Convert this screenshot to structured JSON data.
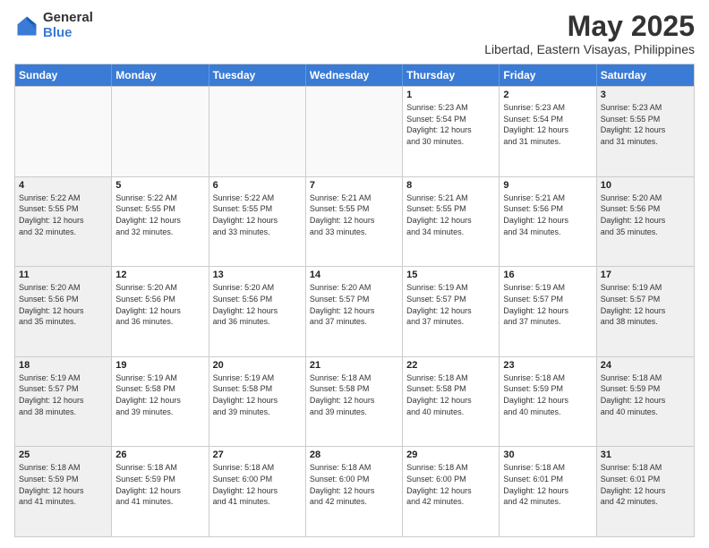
{
  "logo": {
    "general": "General",
    "blue": "Blue"
  },
  "header": {
    "title": "May 2025",
    "subtitle": "Libertad, Eastern Visayas, Philippines"
  },
  "weekdays": [
    "Sunday",
    "Monday",
    "Tuesday",
    "Wednesday",
    "Thursday",
    "Friday",
    "Saturday"
  ],
  "rows": [
    [
      {
        "day": "",
        "text": "",
        "empty": true
      },
      {
        "day": "",
        "text": "",
        "empty": true
      },
      {
        "day": "",
        "text": "",
        "empty": true
      },
      {
        "day": "",
        "text": "",
        "empty": true
      },
      {
        "day": "1",
        "text": "Sunrise: 5:23 AM\nSunset: 5:54 PM\nDaylight: 12 hours\nand 30 minutes.",
        "empty": false
      },
      {
        "day": "2",
        "text": "Sunrise: 5:23 AM\nSunset: 5:54 PM\nDaylight: 12 hours\nand 31 minutes.",
        "empty": false
      },
      {
        "day": "3",
        "text": "Sunrise: 5:23 AM\nSunset: 5:55 PM\nDaylight: 12 hours\nand 31 minutes.",
        "empty": false
      }
    ],
    [
      {
        "day": "4",
        "text": "Sunrise: 5:22 AM\nSunset: 5:55 PM\nDaylight: 12 hours\nand 32 minutes.",
        "empty": false
      },
      {
        "day": "5",
        "text": "Sunrise: 5:22 AM\nSunset: 5:55 PM\nDaylight: 12 hours\nand 32 minutes.",
        "empty": false
      },
      {
        "day": "6",
        "text": "Sunrise: 5:22 AM\nSunset: 5:55 PM\nDaylight: 12 hours\nand 33 minutes.",
        "empty": false
      },
      {
        "day": "7",
        "text": "Sunrise: 5:21 AM\nSunset: 5:55 PM\nDaylight: 12 hours\nand 33 minutes.",
        "empty": false
      },
      {
        "day": "8",
        "text": "Sunrise: 5:21 AM\nSunset: 5:55 PM\nDaylight: 12 hours\nand 34 minutes.",
        "empty": false
      },
      {
        "day": "9",
        "text": "Sunrise: 5:21 AM\nSunset: 5:56 PM\nDaylight: 12 hours\nand 34 minutes.",
        "empty": false
      },
      {
        "day": "10",
        "text": "Sunrise: 5:20 AM\nSunset: 5:56 PM\nDaylight: 12 hours\nand 35 minutes.",
        "empty": false
      }
    ],
    [
      {
        "day": "11",
        "text": "Sunrise: 5:20 AM\nSunset: 5:56 PM\nDaylight: 12 hours\nand 35 minutes.",
        "empty": false
      },
      {
        "day": "12",
        "text": "Sunrise: 5:20 AM\nSunset: 5:56 PM\nDaylight: 12 hours\nand 36 minutes.",
        "empty": false
      },
      {
        "day": "13",
        "text": "Sunrise: 5:20 AM\nSunset: 5:56 PM\nDaylight: 12 hours\nand 36 minutes.",
        "empty": false
      },
      {
        "day": "14",
        "text": "Sunrise: 5:20 AM\nSunset: 5:57 PM\nDaylight: 12 hours\nand 37 minutes.",
        "empty": false
      },
      {
        "day": "15",
        "text": "Sunrise: 5:19 AM\nSunset: 5:57 PM\nDaylight: 12 hours\nand 37 minutes.",
        "empty": false
      },
      {
        "day": "16",
        "text": "Sunrise: 5:19 AM\nSunset: 5:57 PM\nDaylight: 12 hours\nand 37 minutes.",
        "empty": false
      },
      {
        "day": "17",
        "text": "Sunrise: 5:19 AM\nSunset: 5:57 PM\nDaylight: 12 hours\nand 38 minutes.",
        "empty": false
      }
    ],
    [
      {
        "day": "18",
        "text": "Sunrise: 5:19 AM\nSunset: 5:57 PM\nDaylight: 12 hours\nand 38 minutes.",
        "empty": false
      },
      {
        "day": "19",
        "text": "Sunrise: 5:19 AM\nSunset: 5:58 PM\nDaylight: 12 hours\nand 39 minutes.",
        "empty": false
      },
      {
        "day": "20",
        "text": "Sunrise: 5:19 AM\nSunset: 5:58 PM\nDaylight: 12 hours\nand 39 minutes.",
        "empty": false
      },
      {
        "day": "21",
        "text": "Sunrise: 5:18 AM\nSunset: 5:58 PM\nDaylight: 12 hours\nand 39 minutes.",
        "empty": false
      },
      {
        "day": "22",
        "text": "Sunrise: 5:18 AM\nSunset: 5:58 PM\nDaylight: 12 hours\nand 40 minutes.",
        "empty": false
      },
      {
        "day": "23",
        "text": "Sunrise: 5:18 AM\nSunset: 5:59 PM\nDaylight: 12 hours\nand 40 minutes.",
        "empty": false
      },
      {
        "day": "24",
        "text": "Sunrise: 5:18 AM\nSunset: 5:59 PM\nDaylight: 12 hours\nand 40 minutes.",
        "empty": false
      }
    ],
    [
      {
        "day": "25",
        "text": "Sunrise: 5:18 AM\nSunset: 5:59 PM\nDaylight: 12 hours\nand 41 minutes.",
        "empty": false
      },
      {
        "day": "26",
        "text": "Sunrise: 5:18 AM\nSunset: 5:59 PM\nDaylight: 12 hours\nand 41 minutes.",
        "empty": false
      },
      {
        "day": "27",
        "text": "Sunrise: 5:18 AM\nSunset: 6:00 PM\nDaylight: 12 hours\nand 41 minutes.",
        "empty": false
      },
      {
        "day": "28",
        "text": "Sunrise: 5:18 AM\nSunset: 6:00 PM\nDaylight: 12 hours\nand 42 minutes.",
        "empty": false
      },
      {
        "day": "29",
        "text": "Sunrise: 5:18 AM\nSunset: 6:00 PM\nDaylight: 12 hours\nand 42 minutes.",
        "empty": false
      },
      {
        "day": "30",
        "text": "Sunrise: 5:18 AM\nSunset: 6:01 PM\nDaylight: 12 hours\nand 42 minutes.",
        "empty": false
      },
      {
        "day": "31",
        "text": "Sunrise: 5:18 AM\nSunset: 6:01 PM\nDaylight: 12 hours\nand 42 minutes.",
        "empty": false
      }
    ]
  ]
}
